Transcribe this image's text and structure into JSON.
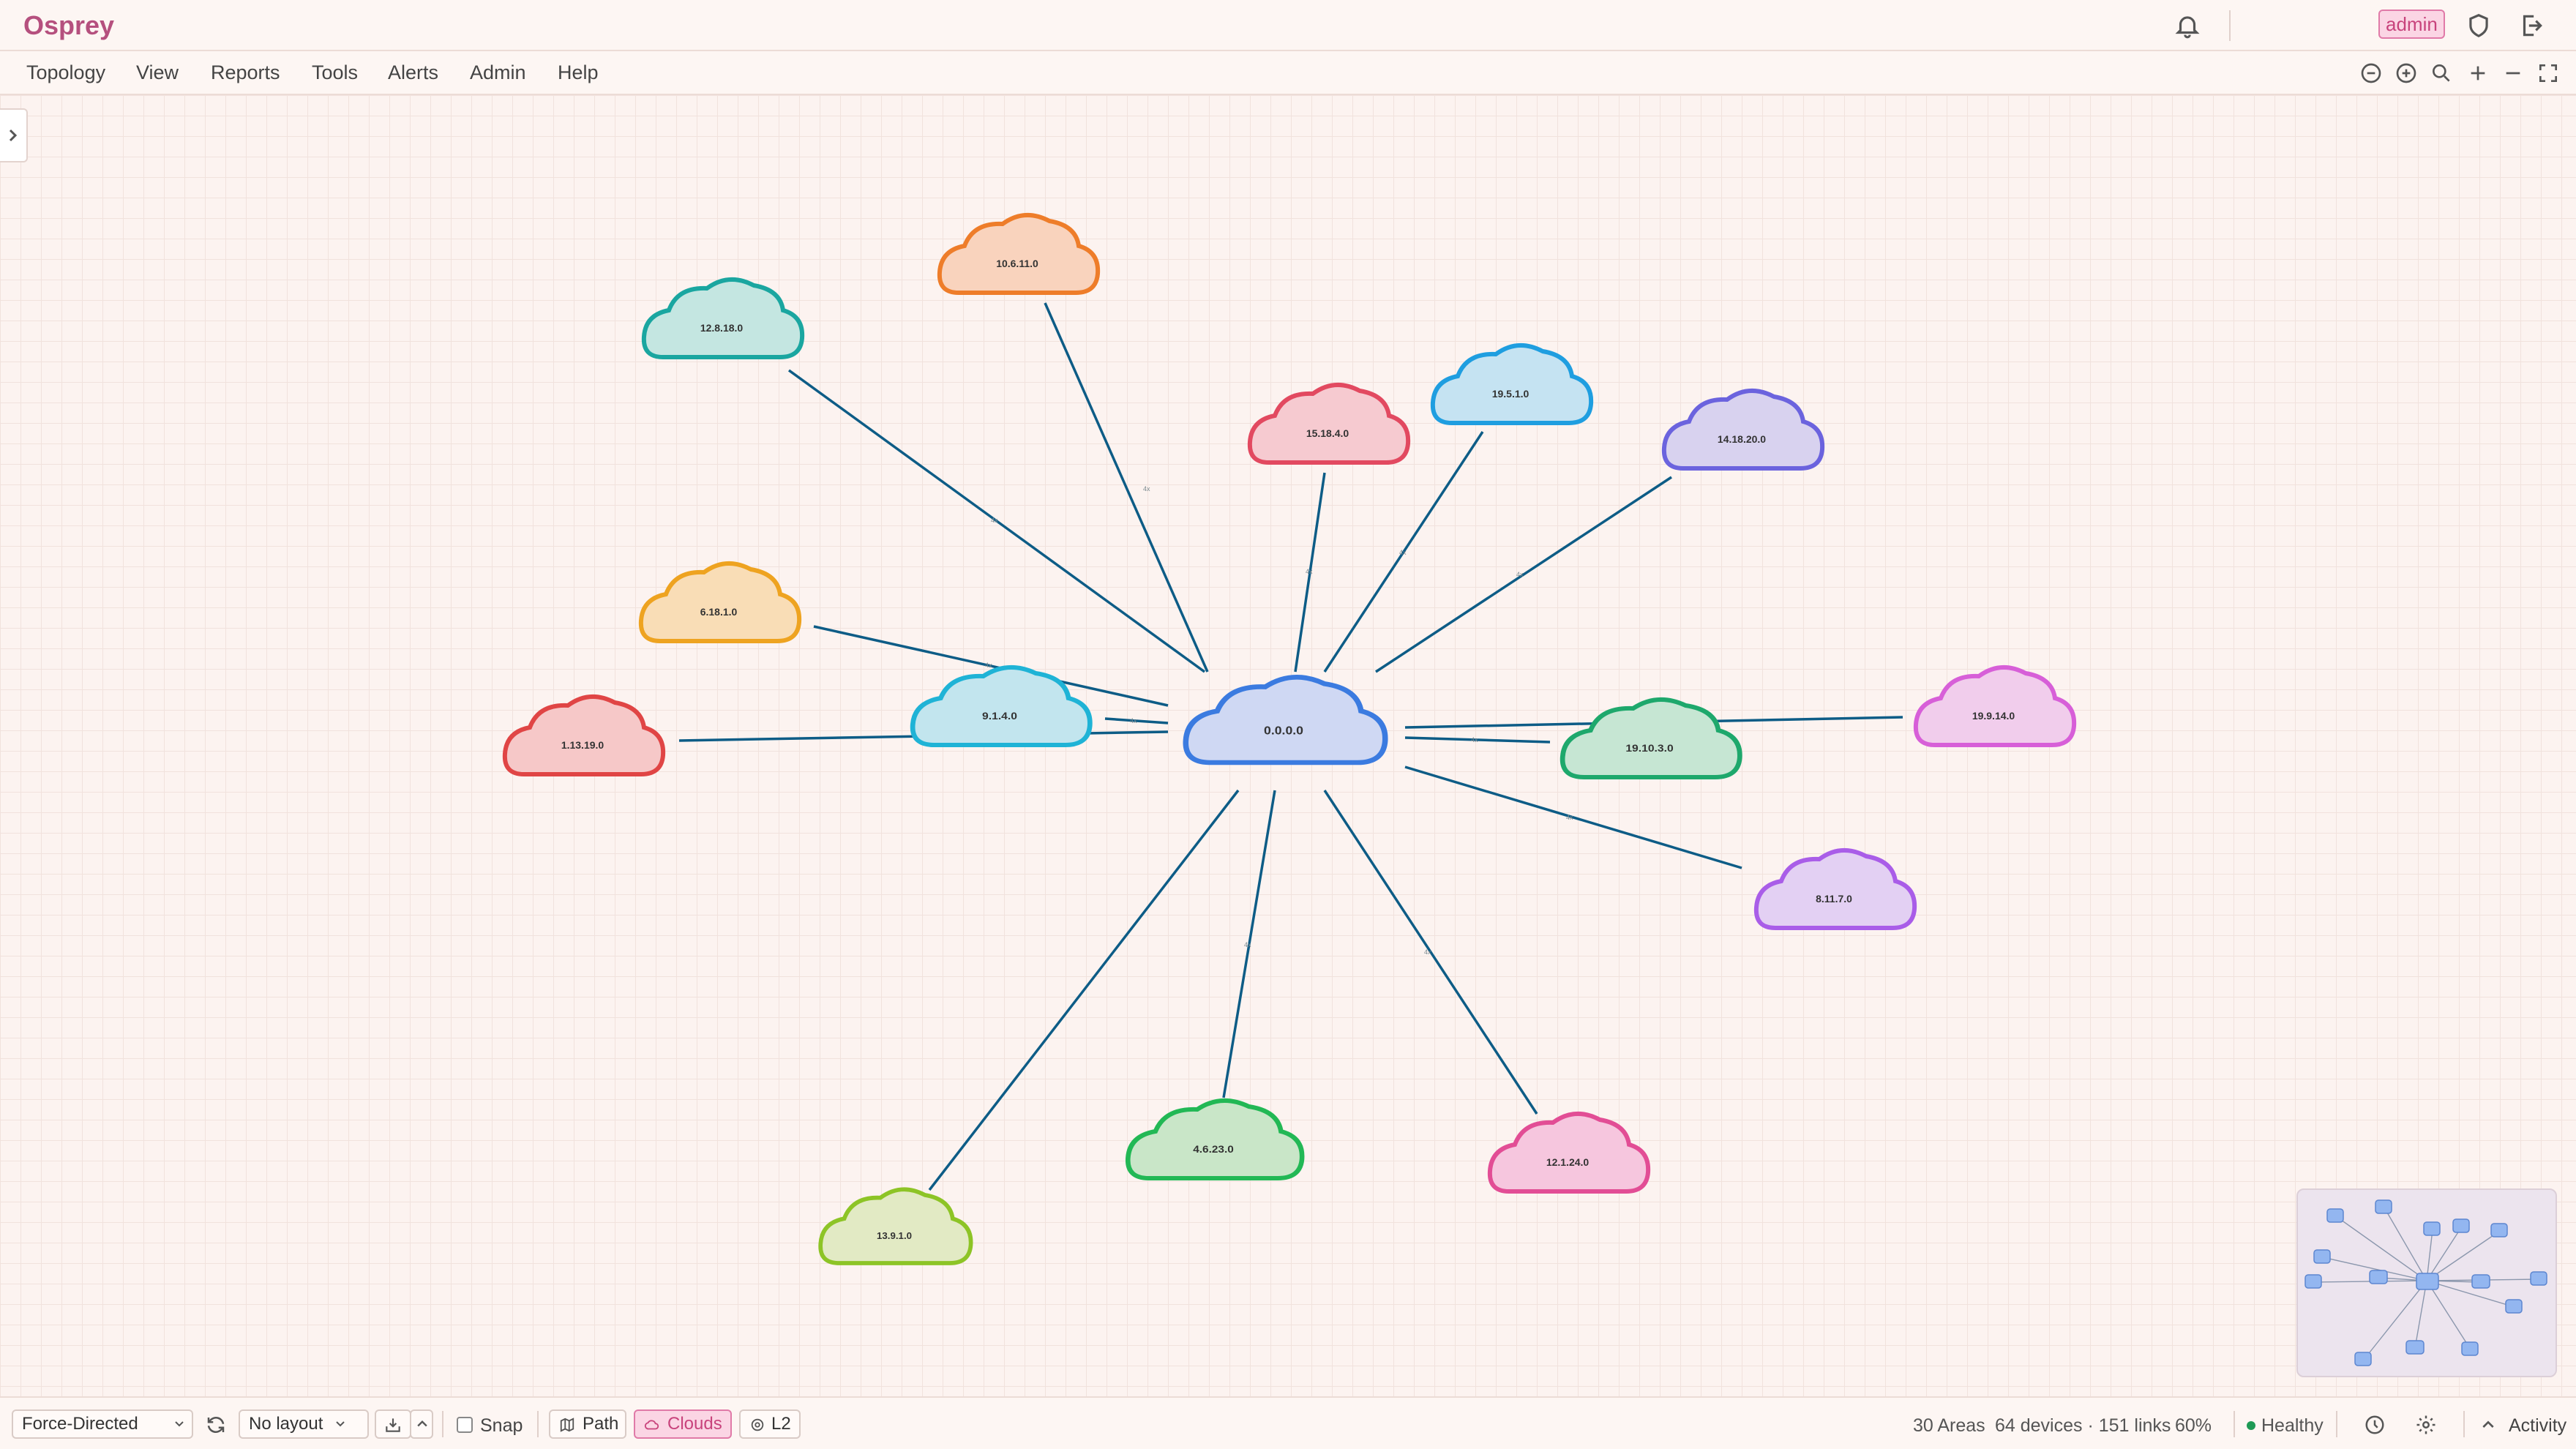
{
  "app": {
    "title": "Osprey",
    "user_badge": "admin"
  },
  "menu": [
    "Topology",
    "View",
    "Reports",
    "Tools",
    "Alerts",
    "Admin",
    "Help"
  ],
  "toolbar_icons": [
    "zoom-out-icon",
    "zoom-in-icon",
    "search-icon",
    "plus-icon",
    "minus-icon",
    "fit-screen-icon"
  ],
  "topology": {
    "center": "0.0.0.0",
    "areas": [
      "10.6.11.0",
      "12.8.18.0",
      "15.18.4.0",
      "19.5.1.0",
      "14.18.20.0",
      "6.18.1.0",
      "9.1.4.0",
      "1.13.19.0",
      "19.10.3.0",
      "19.9.14.0",
      "8.11.7.0",
      "4.6.23.0",
      "12.1.24.0",
      "13.9.1.0"
    ],
    "colors": {
      "center": "#3b7be0",
      "10.6.11.0": "#ee7d2a",
      "12.8.18.0": "#1aa6a0",
      "15.18.4.0": "#e24960",
      "19.5.1.0": "#1f9ee0",
      "14.18.20.0": "#6b63de",
      "6.18.1.0": "#eea320",
      "9.1.4.0": "#1fb3d6",
      "1.13.19.0": "#e04545",
      "19.10.3.0": "#1ea86c",
      "19.9.14.0": "#d75fd8",
      "8.11.7.0": "#a95de8",
      "4.6.23.0": "#22b855",
      "12.1.24.0": "#e24d95",
      "13.9.1.0": "#8dc426",
      "link": "#0d5c86"
    }
  },
  "bottom": {
    "layout_algorithm": "Force-Directed",
    "layout_preset": "No layout",
    "snap_label": "Snap",
    "snap_checked": false,
    "path_label": "Path",
    "clouds_label": "Clouds",
    "l2_label": "L2",
    "areas": "30 Areas",
    "devices_links": "64 devices · 151 links",
    "zoom": "60%",
    "health": "Healthy",
    "health_color": "#1e9a55",
    "activity": "Activity"
  }
}
